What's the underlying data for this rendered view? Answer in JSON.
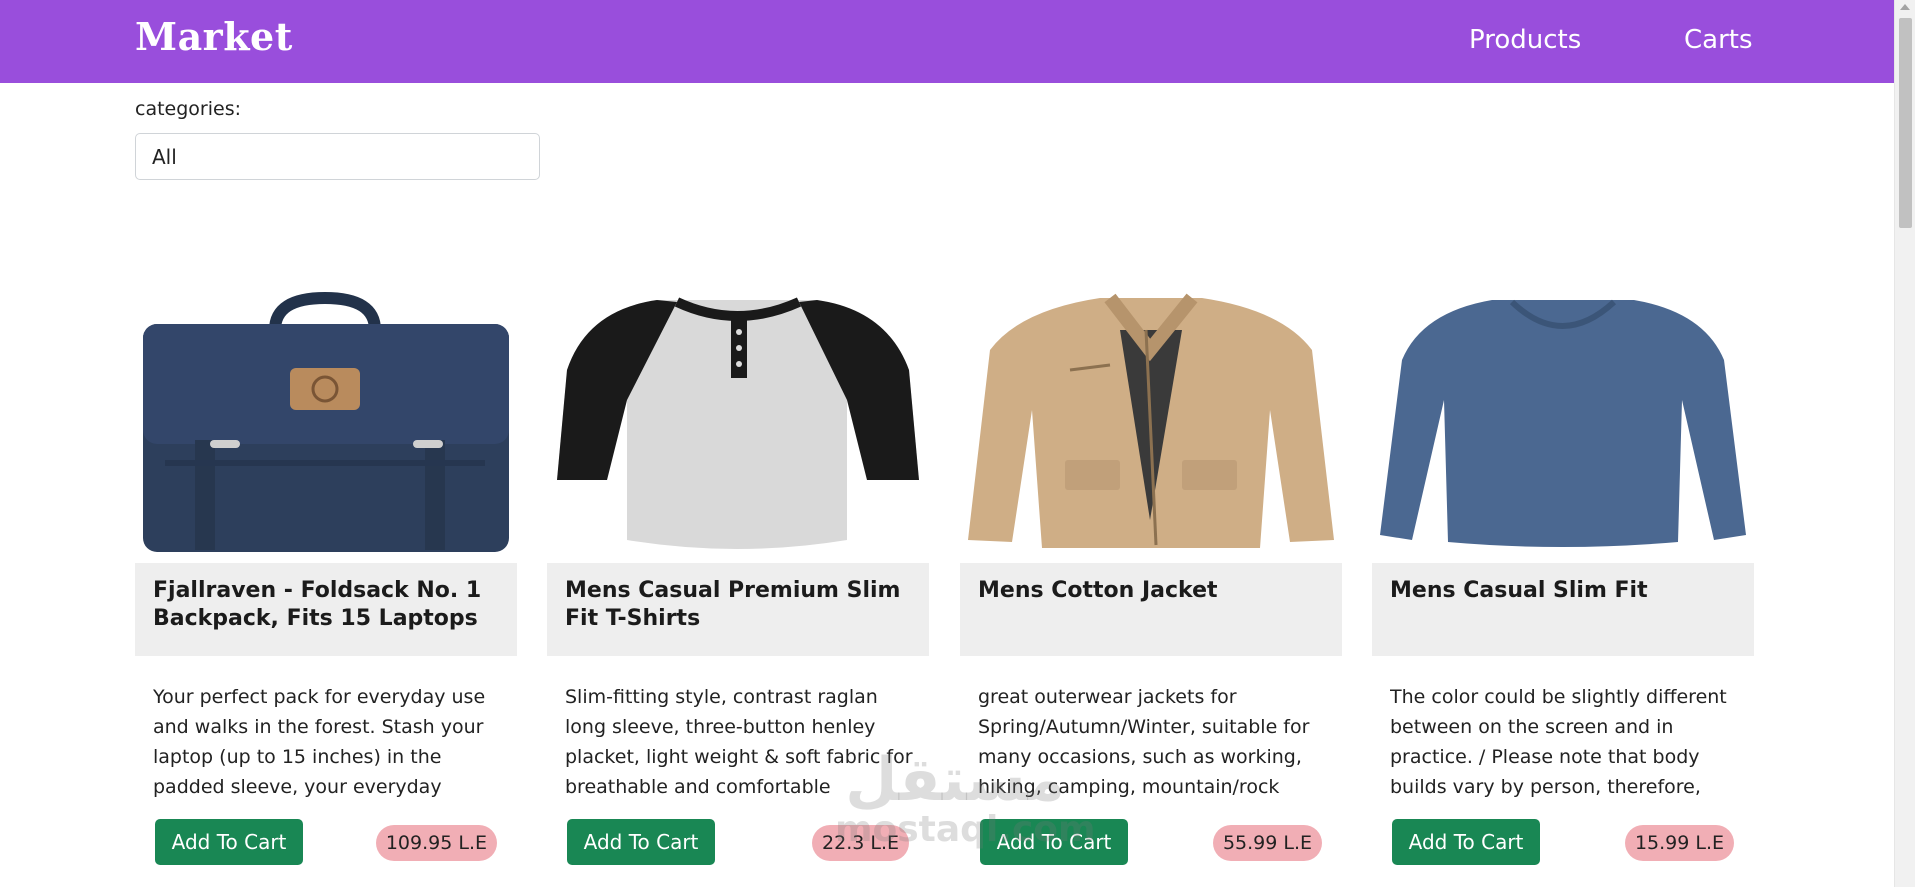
{
  "navbar": {
    "brand": "Market",
    "links": [
      "Products",
      "Carts"
    ],
    "color": "#994edc"
  },
  "filter": {
    "label": "categories:",
    "selected": "All"
  },
  "products": [
    {
      "title": "Fjallraven - Foldsack No. 1 Backpack, Fits 15 Laptops",
      "description": "Your perfect pack for everyday use and walks in the forest. Stash your laptop (up to 15 inches) in the padded sleeve, your everyday",
      "button": "Add To Cart",
      "price": "109.95 L.E",
      "image_icon": "backpack-icon"
    },
    {
      "title": "Mens Casual Premium Slim Fit T-Shirts",
      "description": "Slim-fitting style, contrast raglan long sleeve, three-button henley placket, light weight & soft fabric for breathable and comfortable",
      "button": "Add To Cart",
      "price": "22.3 L.E",
      "image_icon": "tshirt-icon"
    },
    {
      "title": "Mens Cotton Jacket",
      "description": "great outerwear jackets for Spring/Autumn/Winter, suitable for many occasions, such as working, hiking, camping, mountain/rock",
      "button": "Add To Cart",
      "price": "55.99 L.E",
      "image_icon": "jacket-icon"
    },
    {
      "title": "Mens Casual Slim Fit",
      "description": "The color could be slightly different between on the screen and in practice. / Please note that body builds vary by person, therefore,",
      "button": "Add To Cart",
      "price": "15.99 L.E",
      "image_icon": "longsleeve-shirt-icon"
    }
  ],
  "colors": {
    "button": "#198754",
    "price_badge": "#f1aeb5",
    "title_bg": "#eeeeee"
  },
  "watermark": {
    "text": "مستقل",
    "subtext": "mostaql.com"
  }
}
